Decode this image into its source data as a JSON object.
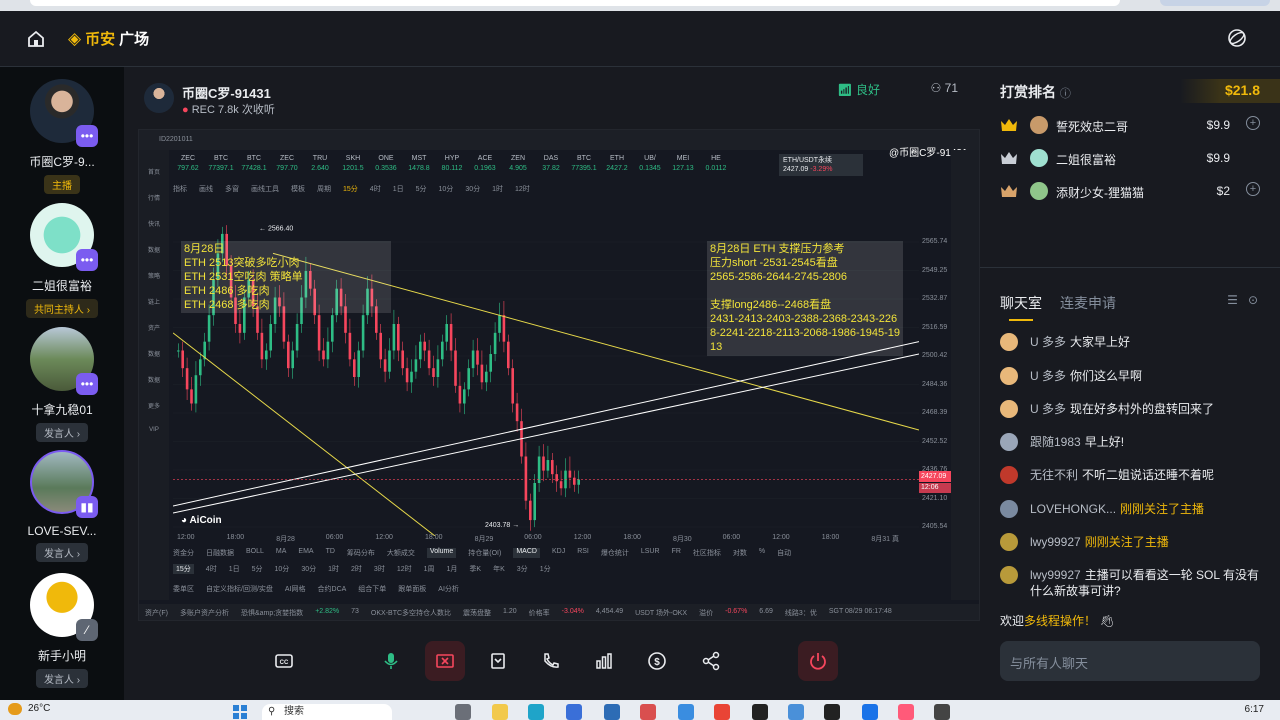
{
  "brand": {
    "name_part1": "币安",
    "name_part2": "广场"
  },
  "members": [
    {
      "name": "币圈C罗-9...",
      "role": "主播"
    },
    {
      "name": "二姐很富裕",
      "role": "共同主持人 ›"
    },
    {
      "name": "十拿九稳01",
      "role": "发言人 ›"
    },
    {
      "name": "LOVE-SEV...",
      "role": "发言人 ›"
    },
    {
      "name": "新手小明",
      "role": "发言人 ›"
    }
  ],
  "stage": {
    "host_name": "币圈C罗-91431",
    "rec_label": "REC",
    "plays": "7.8k 次收听",
    "network": "良好",
    "viewers": "71"
  },
  "screen_share": {
    "watermark": "@币圈C罗-91431",
    "account_id": "ID2201011",
    "pair_tab": "ETH/USDT永续",
    "pair_price": "2427.09",
    "pair_change": "-3.29%",
    "tickers": [
      {
        "sym": "ZEC",
        "val": "797.62"
      },
      {
        "sym": "BTC",
        "val": "77397.1"
      },
      {
        "sym": "BTC",
        "val": "77428.1"
      },
      {
        "sym": "ZEC",
        "val": "797.70"
      },
      {
        "sym": "TRU",
        "val": "2.640"
      },
      {
        "sym": "SKH",
        "val": "1201.5"
      },
      {
        "sym": "ONE",
        "val": "0.3536"
      },
      {
        "sym": "MST",
        "val": "1478.8"
      },
      {
        "sym": "HYP",
        "val": "80.112"
      },
      {
        "sym": "ACE",
        "val": "0.1963"
      },
      {
        "sym": "ZEN",
        "val": "4.905"
      },
      {
        "sym": "DAS",
        "val": "37.82"
      },
      {
        "sym": "BTC",
        "val": "77395.1"
      },
      {
        "sym": "ETH",
        "val": "2427.2"
      },
      {
        "sym": "UB/",
        "val": "0.1345"
      },
      {
        "sym": "MEI",
        "val": "127.13"
      },
      {
        "sym": "HE",
        "val": "0.0112"
      }
    ],
    "tool_labels": [
      "指标",
      "画线",
      "多窗",
      "画线工具",
      "模板",
      "周期",
      "15分",
      "4时",
      "1日",
      "5分",
      "10分",
      "30分",
      "1时",
      "12时"
    ],
    "annot_left": [
      "8月28日",
      "ETH 2513突破多吃小肉",
      "ETH 2531空吃肉  策略单",
      "ETH 2486 多吃肉",
      "ETH  2468 多吃肉"
    ],
    "annot_right": [
      "8月28日 ETH 支撑压力参考",
      "压力short -2531-2545看盘",
      "2565-2586-2644-2745-2806",
      "",
      "支撑long2486--2468看盘",
      "2431-2413-2403-2388-2368-2343-2268-2241-2218-2113-2068-1986-1945-1913"
    ],
    "price_ticks": [
      "2565.74",
      "2549.25",
      "2532.87",
      "2516.59",
      "2500.42",
      "2484.36",
      "2468.39",
      "2452.52",
      "2436.76",
      "2421.10",
      "2405.54"
    ],
    "high_label": "2566.40",
    "low_label": "2403.78",
    "current_price": "2427.09",
    "countdown": "12:06",
    "time_ticks": [
      "12:00",
      "18:00",
      "8月28",
      "06:00",
      "12:00",
      "18:00",
      "8月29",
      "06:00",
      "12:00",
      "18:00",
      "8月30",
      "06:00",
      "12:00",
      "18:00",
      "8月31 真"
    ],
    "aicoin": "AiCoin",
    "bottom_row1": [
      "资金分",
      "日融数据",
      "BOLL",
      "MA",
      "EMA",
      "TD",
      "筹码分布",
      "大额成交",
      "Volume",
      "持仓量(OI)",
      "MACD",
      "KDJ",
      "RSI",
      "爆仓统计",
      "LSUR",
      "FR",
      "社区指标",
      "对数",
      "%",
      "自动"
    ],
    "bottom_row2": [
      "15分",
      "4时",
      "1日",
      "5分",
      "10分",
      "30分",
      "1时",
      "2时",
      "3时",
      "12时",
      "1周",
      "1月",
      "季K",
      "年K",
      "3分",
      "1分"
    ],
    "bottom_row3": [
      "委单区",
      "自定义指标/回测/实盘",
      "AI网格",
      "合约DCA",
      "组合下单",
      "跟单面板",
      "AI分析"
    ],
    "status_items": [
      "资产(F)",
      "多账户资产分析",
      "恐惧&amp;贪婪指数",
      "+2.82%",
      "73",
      "OKX-BTC多空持仓人数比",
      "震荡盘整",
      "1.20",
      "价格率",
      "-3.04%",
      "4,454.49",
      "USDT 场外-OKX",
      "溢价",
      "-0.67%",
      "6.69",
      "线路3：优",
      "SGT 08/29 06:17:48"
    ]
  },
  "rank": {
    "title": "打赏排名",
    "total": "$21.8",
    "rows": [
      {
        "pos": "1",
        "name": "誓死效忠二哥",
        "amount": "$9.9"
      },
      {
        "pos": "2",
        "name": "二姐很富裕",
        "amount": "$9.9"
      },
      {
        "pos": "3",
        "name": "添财少女-狸猫猫",
        "amount": "$2"
      }
    ]
  },
  "chat": {
    "tab_active": "聊天室",
    "tab_other": "连麦申请",
    "messages": [
      {
        "user": "U 多多",
        "text": "大家早上好",
        "sys": ""
      },
      {
        "user": "U 多多",
        "text": "你们这么早啊",
        "sys": ""
      },
      {
        "user": "U 多多",
        "text": "现在好多村外的盘转回来了",
        "sys": ""
      },
      {
        "user": "跟随1983",
        "text": "早上好!",
        "sys": ""
      },
      {
        "user": "无往不利",
        "text": "不听二姐说话还睡不着呢",
        "sys": ""
      },
      {
        "user": "LOVEHONGK...",
        "text": "",
        "sys": "刚刚关注了主播"
      },
      {
        "user": "lwy99927",
        "text": "",
        "sys": "刚刚关注了主播"
      },
      {
        "user": "lwy99927",
        "text": "主播可以看看这一轮 SOL 有没有什么新故事可讲?",
        "sys": ""
      }
    ],
    "welcome_prefix": "欢迎",
    "welcome_hl": "多线程操作！",
    "input_placeholder": "与所有人聊天"
  },
  "taskbar": {
    "temperature": "26°C",
    "search": "搜索",
    "time": "6:17"
  }
}
